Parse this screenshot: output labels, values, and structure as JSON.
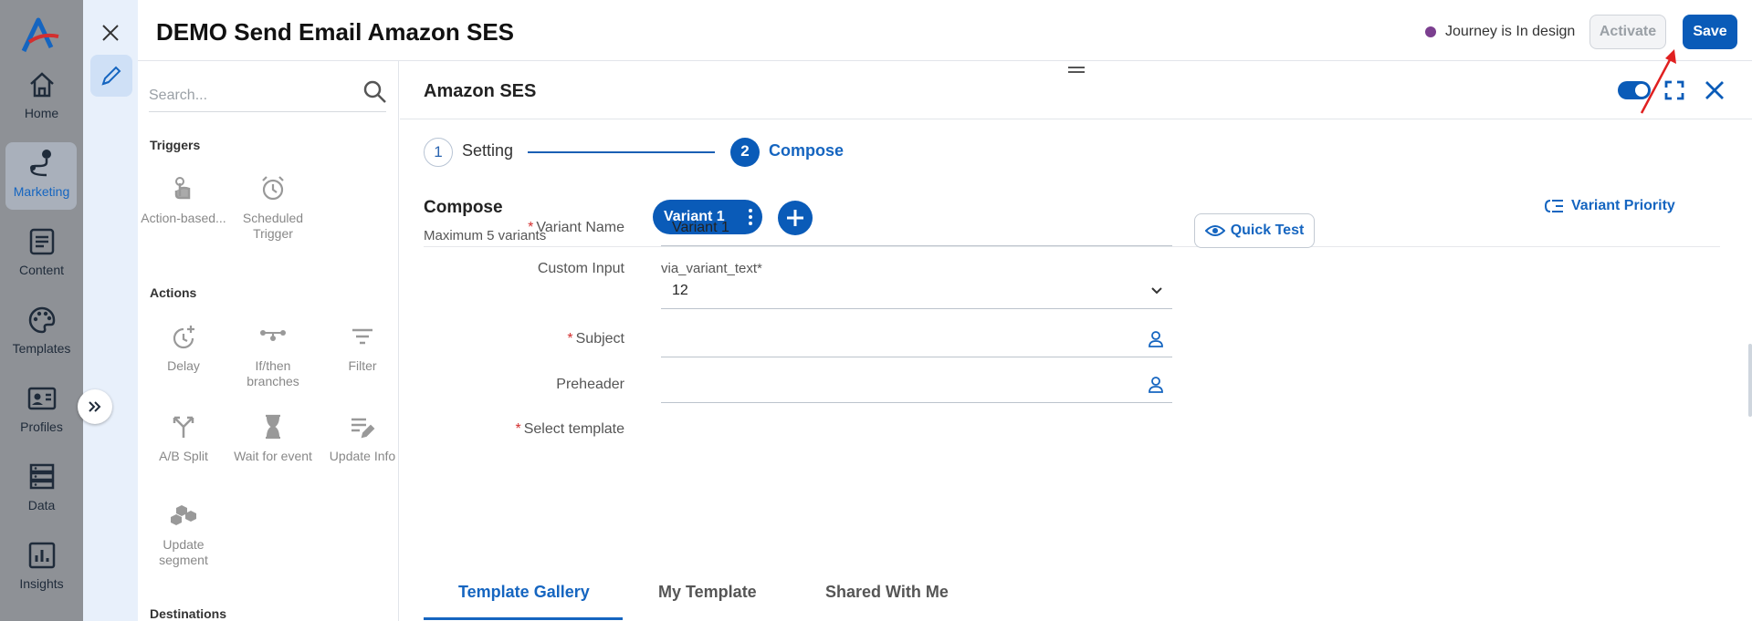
{
  "nav": {
    "items": [
      {
        "label": "Home",
        "icon": "home-icon"
      },
      {
        "label": "Marketing",
        "icon": "journey-icon",
        "active": true
      },
      {
        "label": "Content",
        "icon": "content-icon"
      },
      {
        "label": "Templates",
        "icon": "palette-icon"
      },
      {
        "label": "Profiles",
        "icon": "profile-card-icon"
      },
      {
        "label": "Data",
        "icon": "database-icon"
      },
      {
        "label": "Insights",
        "icon": "chart-icon"
      }
    ]
  },
  "header": {
    "title": "DEMO Send Email Amazon SES",
    "status": "Journey is In design",
    "status_color": "#7b3f8f",
    "activate_label": "Activate",
    "save_label": "Save"
  },
  "palette": {
    "search_placeholder": "Search...",
    "triggers_title": "Triggers",
    "triggers": [
      {
        "label": "Action-based...",
        "icon": "tap-icon"
      },
      {
        "label": "Scheduled Trigger",
        "icon": "alarm-clock-icon"
      }
    ],
    "actions_title": "Actions",
    "actions": [
      {
        "label": "Delay",
        "icon": "delay-icon"
      },
      {
        "label": "If/then branches",
        "icon": "branch-icon"
      },
      {
        "label": "Filter",
        "icon": "filter-icon"
      },
      {
        "label": "A/B Split",
        "icon": "split-icon"
      },
      {
        "label": "Wait for event",
        "icon": "hourglass-icon"
      },
      {
        "label": "Update Info",
        "icon": "edit-list-icon"
      },
      {
        "label": "Update segment",
        "icon": "segment-icon"
      }
    ],
    "destinations_title": "Destinations"
  },
  "panel": {
    "title": "Amazon SES",
    "steps": [
      {
        "number": "1",
        "label": "Setting"
      },
      {
        "number": "2",
        "label": "Compose"
      }
    ],
    "compose_title": "Compose",
    "compose_subtitle": "Maximum 5 variants",
    "variant_chip": "Variant 1",
    "variant_priority": "Variant Priority",
    "quick_test": "Quick Test",
    "form": {
      "variant_name_label": "Variant Name",
      "variant_name_value": "Variant 1",
      "custom_input_label": "Custom Input",
      "custom_input_var": "via_variant_text*",
      "custom_input_value": "12",
      "subject_label": "Subject",
      "subject_value": "",
      "preheader_label": "Preheader",
      "preheader_value": "",
      "select_template_label": "Select template"
    },
    "tabs": [
      "Template Gallery",
      "My Template",
      "Shared With Me"
    ]
  },
  "colors": {
    "primary": "#0a5bb8",
    "nav_bg": "#8e9196",
    "required": "#d32f2f"
  }
}
